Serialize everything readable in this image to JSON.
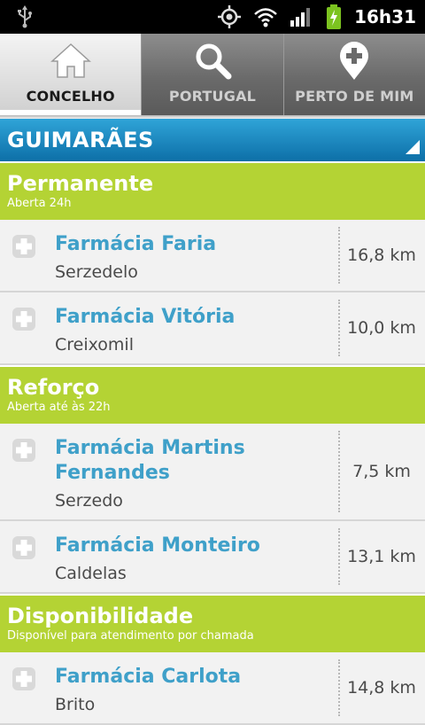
{
  "status_bar": {
    "time": "16h31",
    "icons": [
      "usb-icon",
      "gps-icon",
      "wifi-icon",
      "signal-icon",
      "battery-charging-icon"
    ],
    "battery_color": "#7cc320"
  },
  "tabs": [
    {
      "label": "CONCELHO",
      "icon": "home-icon",
      "active": true
    },
    {
      "label": "PORTUGAL",
      "icon": "search-icon",
      "active": false
    },
    {
      "label": "PERTO DE MIM",
      "icon": "location-cross-icon",
      "active": false
    }
  ],
  "region": {
    "name": "GUIMARÃES"
  },
  "colors": {
    "accent_green": "#b4d334",
    "region_blue": "#1a88c0",
    "name_blue": "#3fa0c9"
  },
  "sections": [
    {
      "title": "Permanente",
      "subtitle": "Aberta 24h",
      "items": [
        {
          "name": "Farmácia Faria",
          "place": "Serzedelo",
          "distance": "16,8 km"
        },
        {
          "name": "Farmácia Vitória",
          "place": "Creixomil",
          "distance": "10,0 km"
        }
      ]
    },
    {
      "title": "Reforço",
      "subtitle": "Aberta até às 22h",
      "items": [
        {
          "name": "Farmácia Martins Fernandes",
          "place": "Serzedo",
          "distance": "7,5 km"
        },
        {
          "name": "Farmácia Monteiro",
          "place": "Caldelas",
          "distance": "13,1 km"
        }
      ]
    },
    {
      "title": "Disponibilidade",
      "subtitle": "Disponível para atendimento por chamada",
      "items": [
        {
          "name": "Farmácia Carlota",
          "place": "Brito",
          "distance": "14,8 km"
        }
      ]
    }
  ]
}
